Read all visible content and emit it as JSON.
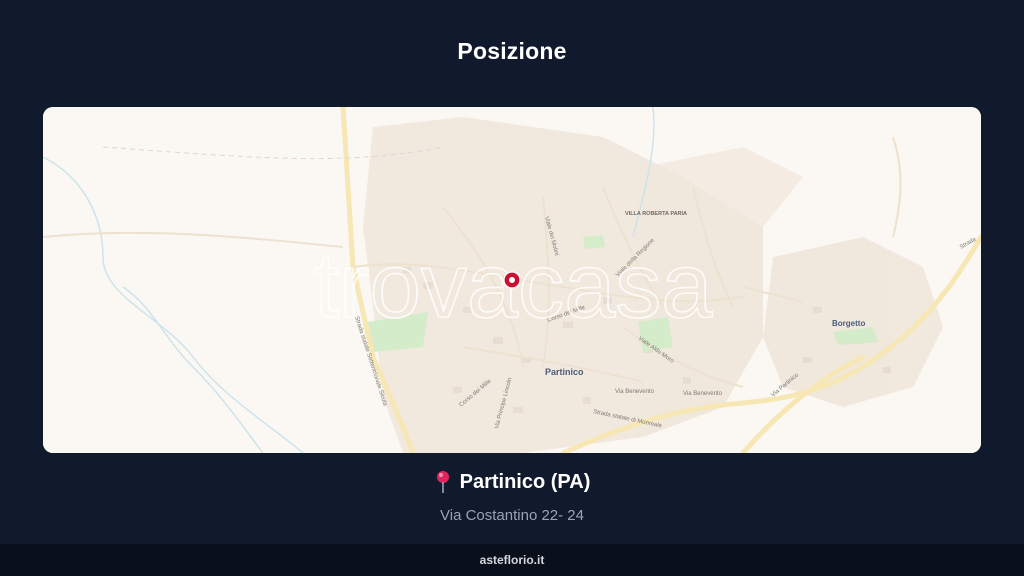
{
  "header": {
    "title": "Posizione"
  },
  "map": {
    "watermark": "trovacasa",
    "labels": {
      "town_main": "Partinico",
      "town_secondary": "Borgetto",
      "poi": "VILLA ROBERTA PARIA",
      "road_ss_sicula": "Strada statale Settentrionale Sicula",
      "road_monreale": "Strada statale di Monreale",
      "road_benevento_1": "Via Benevento",
      "road_benevento_2": "Via Benevento",
      "road_aldo_moro": "Viale Aldo Moro",
      "road_corso_mille": "Corso dei Mille",
      "road_regione": "Viale della Regione",
      "road_lincoln": "Via Principe Lincoln",
      "road_molini": "Viale dei Molini",
      "road_mille2": "Corso dei Mille",
      "road_partinico": "Via Partinico",
      "road_strada": "Strada"
    },
    "colors": {
      "background": "#fbf7f2",
      "roads": "#f6e7b4",
      "urban": "#efe6da",
      "park": "#d4ecc9",
      "water": "#c9e3ec",
      "marker": "#c8102e"
    }
  },
  "location": {
    "pin_icon": "round-pushpin-icon",
    "title": "Partinico (PA)",
    "address": "Via Costantino 22- 24"
  },
  "footer": {
    "site": "asteflorio.it"
  }
}
